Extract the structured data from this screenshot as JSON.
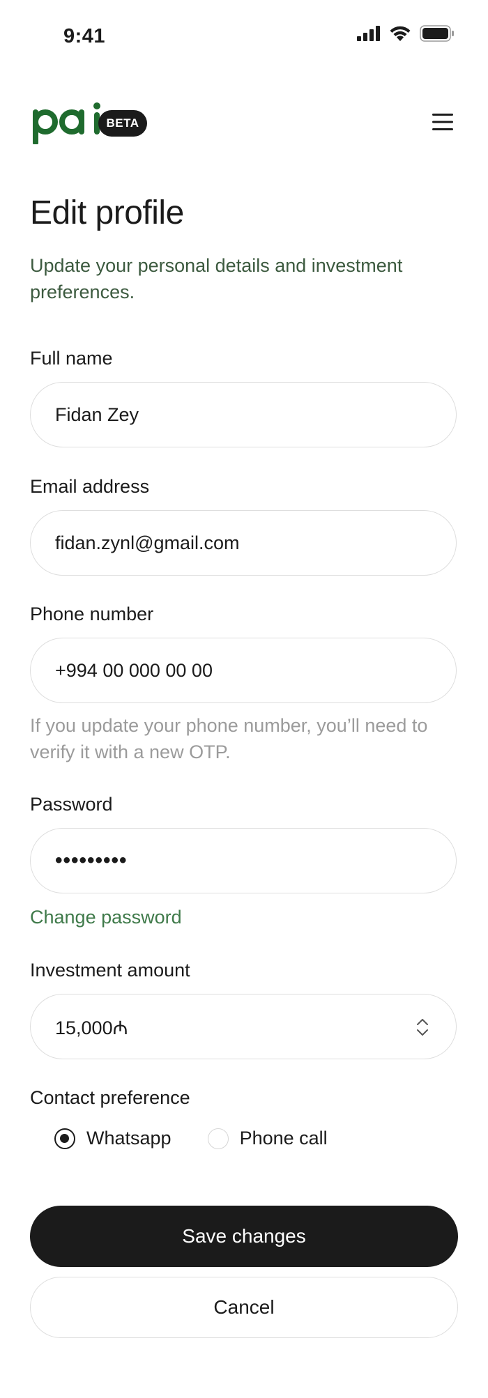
{
  "status_bar": {
    "time": "9:41"
  },
  "header": {
    "logo_text": "pai",
    "badge": "BETA"
  },
  "page": {
    "title": "Edit profile",
    "subtitle": "Update your personal details and investment preferences."
  },
  "form": {
    "full_name": {
      "label": "Full name",
      "value": "Fidan Zey"
    },
    "email": {
      "label": "Email address",
      "value": "fidan.zynl@gmail.com"
    },
    "phone": {
      "label": "Phone number",
      "value": "+994 00 000 00 00",
      "hint": "If you update your phone number, you’ll need to verify it with a new OTP."
    },
    "password": {
      "label": "Password",
      "value": "•••••••••",
      "change_link": "Change password"
    },
    "investment": {
      "label": "Investment amount",
      "value": "15,000₼"
    },
    "contact": {
      "label": "Contact preference",
      "options": [
        {
          "label": "Whatsapp",
          "selected": true
        },
        {
          "label": "Phone call",
          "selected": false
        }
      ]
    }
  },
  "actions": {
    "save": "Save changes",
    "cancel": "Cancel"
  },
  "colors": {
    "brand_green": "#1f6b2e",
    "text_dark": "#1b1b1b",
    "link_green": "#3f7a4a"
  }
}
